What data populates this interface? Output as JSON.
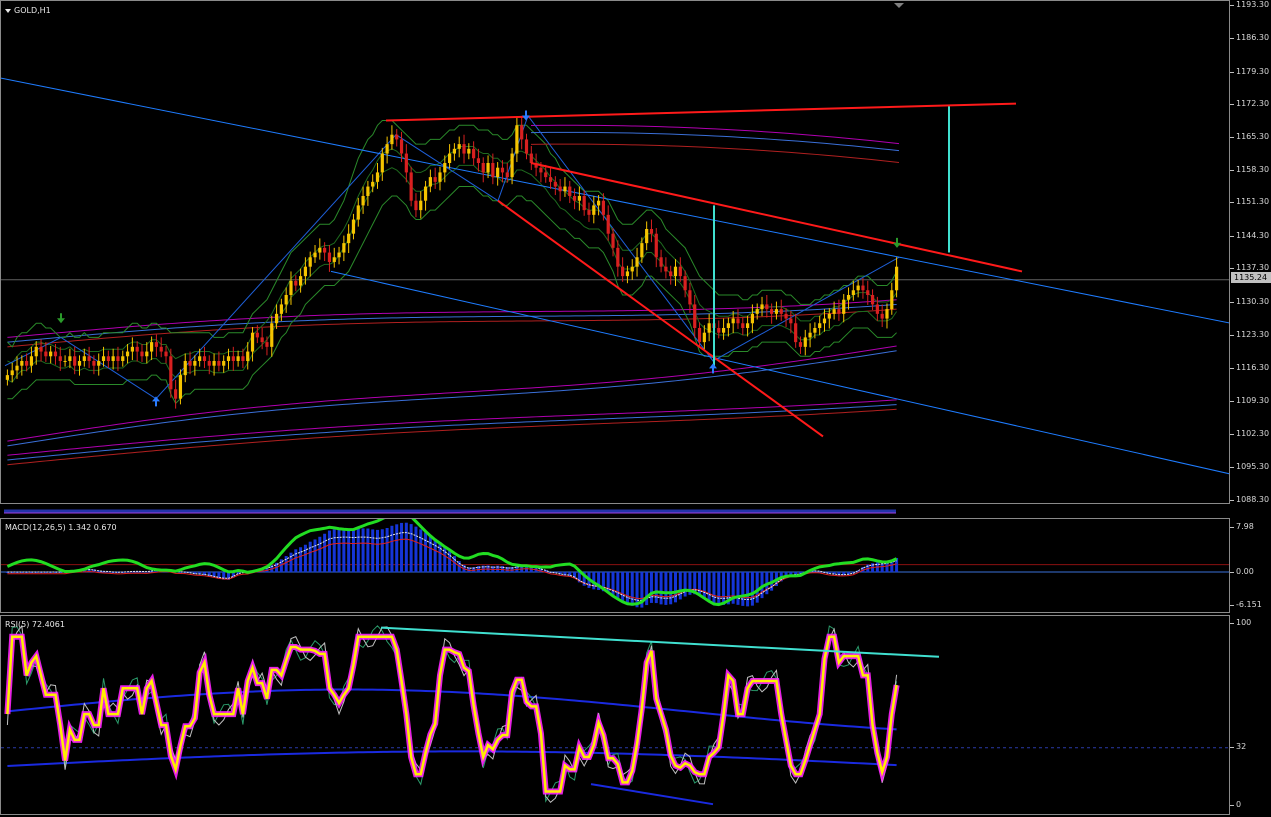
{
  "main": {
    "symbol_label": "GOLD,H1",
    "current_price": "1135.24",
    "price_ticks": [
      "1193.30",
      "1186.30",
      "1179.30",
      "1172.30",
      "1165.30",
      "1158.30",
      "1151.30",
      "1144.30",
      "1137.30",
      "1130.30",
      "1123.30",
      "1116.30",
      "1109.30",
      "1102.30",
      "1095.30",
      "1088.30"
    ],
    "ylim": [
      1088.3,
      1193.3
    ],
    "colors": {
      "bull": "#f5c400",
      "bear": "#d82020",
      "trendline": "#ff1a1a",
      "channel": "#1e7cff",
      "bands": "#2a8a2a",
      "ma": "#b000b0"
    }
  },
  "macd": {
    "label": "MACD(12,26,5) 1.342 0.670",
    "ticks": [
      "7.98",
      "0.00",
      "-6.151"
    ],
    "ylim": [
      -6.151,
      7.98
    ]
  },
  "rsi": {
    "label": "RSI(5) 72.4061",
    "ticks": [
      "100",
      "32",
      "0"
    ],
    "ylim": [
      0,
      100
    ]
  },
  "chart_data": {
    "type": "candlestick",
    "series": [
      {
        "name": "GOLD,H1",
        "close": [
          1115,
          1116,
          1117,
          1118,
          1117,
          1119,
          1121,
          1120,
          1119,
          1120,
          1119,
          1118,
          1118,
          1119,
          1117,
          1118,
          1119,
          1118,
          1117,
          1118,
          1119,
          1118,
          1119,
          1118,
          1119,
          1120,
          1121,
          1120,
          1119,
          1120,
          1122,
          1121,
          1120,
          1119,
          1112,
          1110,
          1115,
          1118,
          1117,
          1118,
          1119,
          1118,
          1117,
          1118,
          1117,
          1118,
          1119,
          1118,
          1119,
          1118,
          1120,
          1124,
          1123,
          1122,
          1121,
          1126,
          1128,
          1130,
          1132,
          1135,
          1134,
          1136,
          1138,
          1140,
          1141,
          1142,
          1141,
          1139,
          1140,
          1141,
          1143,
          1145,
          1148,
          1151,
          1153,
          1155,
          1156,
          1158,
          1162,
          1164,
          1166,
          1165,
          1162,
          1158,
          1152,
          1150,
          1152,
          1155,
          1157,
          1156,
          1158,
          1160,
          1162,
          1163,
          1164,
          1162,
          1163,
          1161,
          1160,
          1158,
          1160,
          1157,
          1159,
          1158,
          1157,
          1162,
          1168,
          1165,
          1162,
          1160,
          1159,
          1158,
          1157,
          1156,
          1155,
          1154,
          1155,
          1153,
          1152,
          1153,
          1150,
          1149,
          1151,
          1152,
          1149,
          1145,
          1142,
          1138,
          1136,
          1137,
          1138,
          1140,
          1143,
          1146,
          1145,
          1140,
          1138,
          1137,
          1136,
          1138,
          1136,
          1133,
          1130,
          1125,
          1122,
          1124,
          1126,
          1125,
          1124,
          1125,
          1126,
          1127,
          1126,
          1125,
          1126,
          1128,
          1129,
          1130,
          1129,
          1128,
          1129,
          1128,
          1127,
          1126,
          1122,
          1121,
          1123,
          1124,
          1125,
          1126,
          1127,
          1128,
          1129,
          1128,
          1131,
          1132,
          1133,
          1134,
          1133,
          1132,
          1130,
          1128,
          1127,
          1129,
          1133,
          1138
        ],
        "upper_bands": [
          1122,
          1121,
          1123,
          1124,
          1124,
          1125,
          1126,
          1126,
          1125,
          1125,
          1124,
          1123,
          1123,
          1124,
          1123,
          1123,
          1124,
          1123,
          1123,
          1123,
          1124,
          1124,
          1124,
          1124,
          1124,
          1125,
          1126,
          1126,
          1125,
          1125,
          1126,
          1126,
          1125,
          1125,
          1124,
          1124,
          1124,
          1124,
          1124,
          1124,
          1124,
          1124,
          1124,
          1123,
          1123,
          1123,
          1124,
          1124,
          1124,
          1124,
          1126,
          1128,
          1129,
          1130,
          1131,
          1133,
          1135,
          1137,
          1139,
          1141,
          1142,
          1143,
          1144,
          1145,
          1146,
          1147,
          1147,
          1147,
          1148,
          1150,
          1152,
          1155,
          1158,
          1161,
          1163,
          1165,
          1166,
          1168,
          1169,
          1169,
          1169,
          1168,
          1167,
          1166,
          1165,
          1164,
          1164,
          1164,
          1165,
          1165,
          1165,
          1166,
          1167,
          1167,
          1168,
          1168,
          1168,
          1168,
          1167,
          1167,
          1167,
          1166,
          1166,
          1165,
          1165,
          1166,
          1168,
          1168,
          1168,
          1167,
          1166,
          1165,
          1164,
          1162,
          1161,
          1159,
          1158,
          1157,
          1156,
          1155,
          1154,
          1154,
          1154,
          1154,
          1153,
          1152,
          1150,
          1148,
          1147,
          1147,
          1147,
          1148,
          1149,
          1150,
          1150,
          1149,
          1148,
          1146,
          1145,
          1144,
          1143,
          1142,
          1140,
          1138,
          1136,
          1135,
          1134,
          1133,
          1132,
          1132,
          1132,
          1132,
          1132,
          1131,
          1131,
          1132,
          1132,
          1133,
          1133,
          1133,
          1133,
          1133,
          1132,
          1132,
          1131,
          1130,
          1130,
          1130,
          1131,
          1131,
          1132,
          1132,
          1133,
          1133,
          1134,
          1134,
          1135,
          1136,
          1136,
          1136,
          1135,
          1134,
          1134,
          1134,
          1135,
          1137
        ],
        "lower_bands": [
          1110,
          1110,
          1111,
          1112,
          1112,
          1113,
          1114,
          1114,
          1114,
          1114,
          1114,
          1114,
          1114,
          1114,
          1113,
          1113,
          1113,
          1113,
          1113,
          1113,
          1113,
          1113,
          1113,
          1113,
          1113,
          1114,
          1114,
          1114,
          1114,
          1114,
          1115,
          1115,
          1114,
          1114,
          1111,
          1109,
          1110,
          1111,
          1111,
          1112,
          1112,
          1112,
          1112,
          1112,
          1112,
          1112,
          1112,
          1112,
          1112,
          1112,
          1113,
          1115,
          1116,
          1117,
          1118,
          1119,
          1121,
          1123,
          1124,
          1126,
          1127,
          1128,
          1130,
          1131,
          1132,
          1133,
          1134,
          1134,
          1134,
          1135,
          1136,
          1137,
          1139,
          1141,
          1143,
          1145,
          1147,
          1149,
          1151,
          1152,
          1153,
          1153,
          1152,
          1151,
          1149,
          1148,
          1148,
          1149,
          1150,
          1150,
          1151,
          1152,
          1153,
          1154,
          1155,
          1155,
          1155,
          1155,
          1154,
          1153,
          1153,
          1152,
          1152,
          1151,
          1151,
          1152,
          1153,
          1153,
          1152,
          1152,
          1151,
          1150,
          1149,
          1148,
          1147,
          1146,
          1146,
          1145,
          1144,
          1144,
          1143,
          1142,
          1142,
          1142,
          1141,
          1139,
          1137,
          1134,
          1132,
          1132,
          1132,
          1133,
          1134,
          1136,
          1136,
          1135,
          1134,
          1133,
          1132,
          1131,
          1130,
          1128,
          1126,
          1123,
          1120,
          1119,
          1119,
          1119,
          1119,
          1119,
          1119,
          1120,
          1120,
          1120,
          1120,
          1121,
          1121,
          1122,
          1122,
          1122,
          1122,
          1122,
          1122,
          1121,
          1120,
          1119,
          1119,
          1119,
          1120,
          1120,
          1121,
          1121,
          1122,
          1122,
          1123,
          1124,
          1125,
          1125,
          1125,
          1125,
          1124,
          1123,
          1123,
          1123,
          1123,
          1124
        ]
      }
    ],
    "trendlines": {
      "top_resistance": [
        [
          385,
          1169
        ],
        [
          1015,
          1172.6
        ]
      ],
      "descending_resistance": [
        [
          530,
          1160
        ],
        [
          1021,
          1137
        ]
      ],
      "descending_support": [
        [
          497,
          1152
        ],
        [
          822,
          1102
        ]
      ],
      "blue_upper": [
        [
          0,
          1178
        ],
        [
          1230,
          1126
        ]
      ],
      "blue_lower": [
        [
          330,
          1137
        ],
        [
          1230,
          1094
        ]
      ]
    },
    "measure_line": {
      "x": 948,
      "from": 1141,
      "to": 1172
    }
  }
}
